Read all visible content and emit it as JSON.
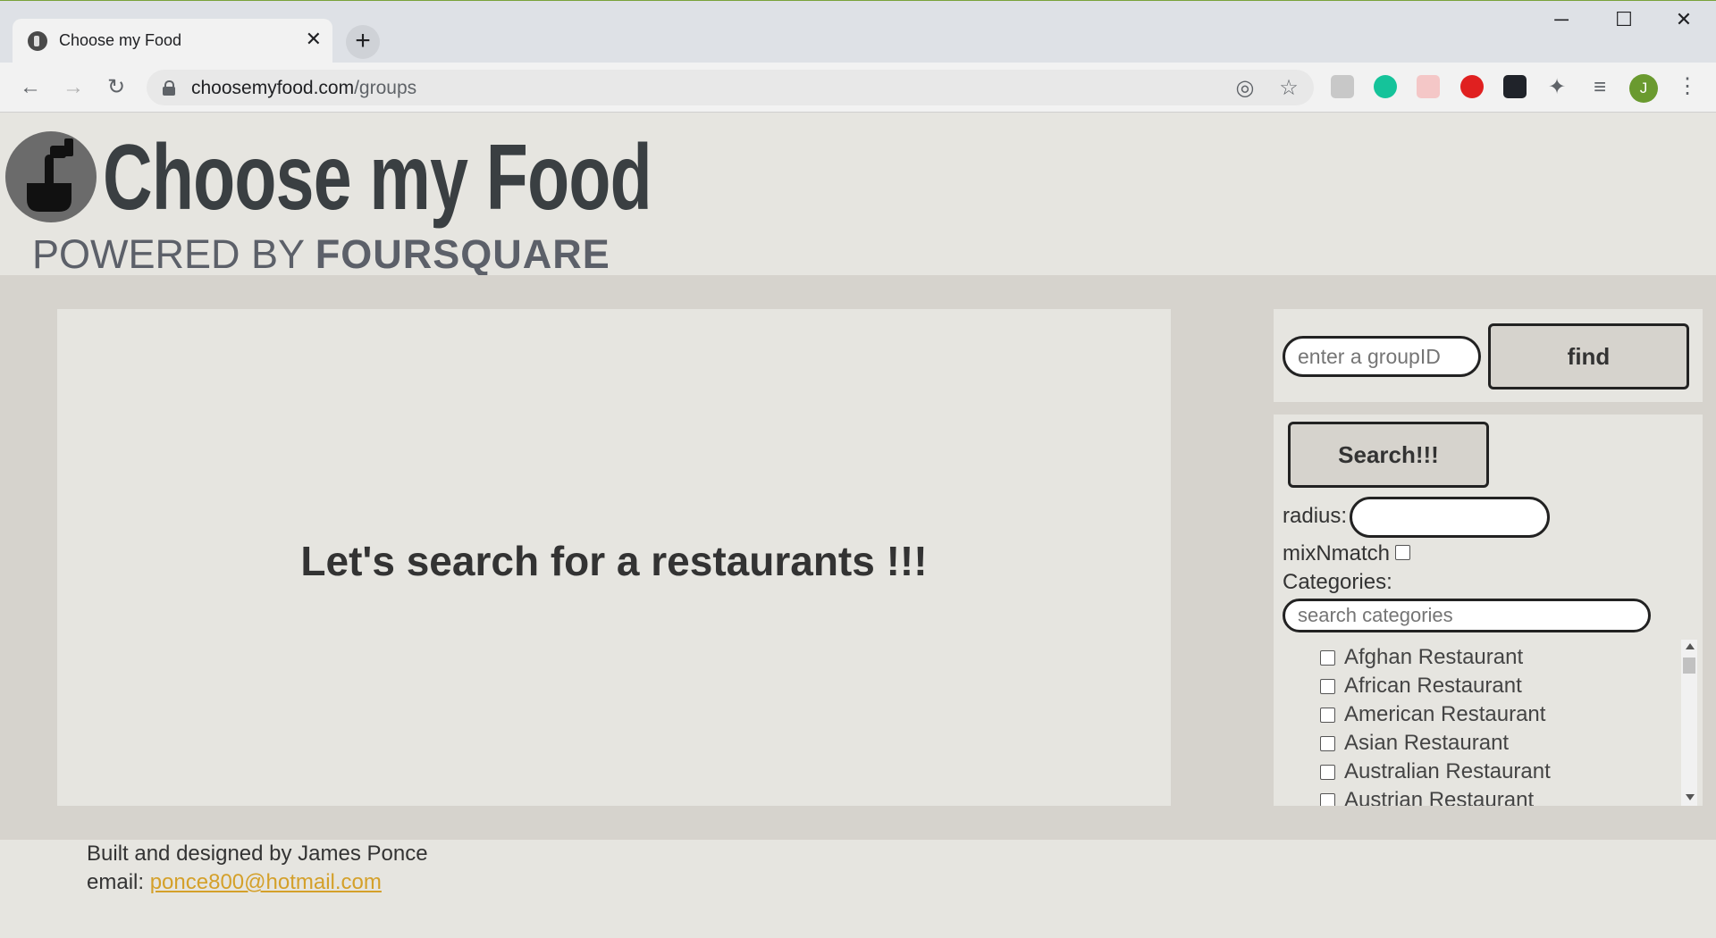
{
  "browser": {
    "tab_title": "Choose my Food",
    "tab_close": "✕",
    "new_tab": "+",
    "url_host": "choosemyfood.com",
    "url_path": "/groups",
    "controls": {
      "minimize": "─",
      "maximize": "☐",
      "close": "✕"
    },
    "avatar_letter": "J"
  },
  "site": {
    "title": "Choose my Food",
    "powered_by": "POWERED BY",
    "powered_brand": "FOURSQUARE"
  },
  "main": {
    "message": "Let's search for a restaurants !!!"
  },
  "group": {
    "placeholder": "enter a groupID",
    "find_label": "find"
  },
  "search": {
    "button_label": "Search!!!",
    "radius_label": "radius:",
    "radius_value": "",
    "mix_label": "mixNmatch",
    "categories_label": "Categories:",
    "categories_placeholder": "search categories",
    "categories": [
      "Afghan Restaurant",
      "African Restaurant",
      "American Restaurant",
      "Asian Restaurant",
      "Australian Restaurant",
      "Austrian Restaurant"
    ]
  },
  "footer": {
    "credit": "Built and designed by James Ponce",
    "email_label": "email:",
    "email": "ponce800@hotmail.com"
  }
}
